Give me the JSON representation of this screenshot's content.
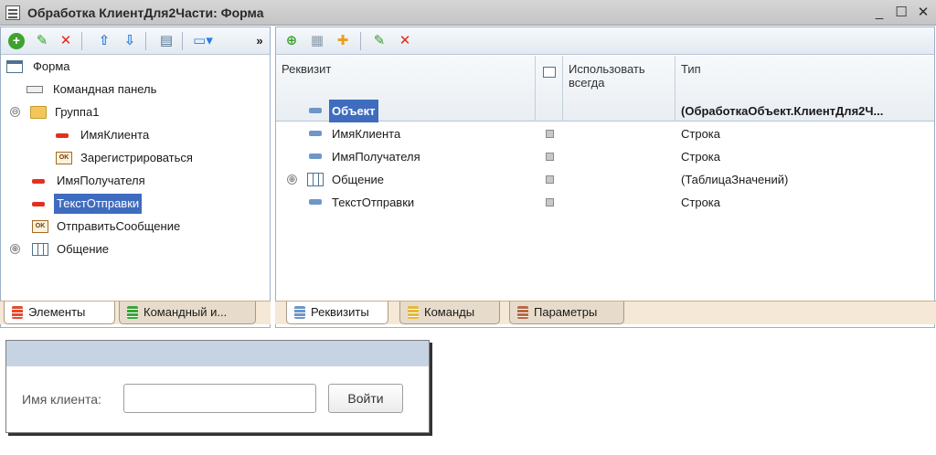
{
  "window": {
    "title": "Обработка КлиентДля2Части: Форма",
    "controls": {
      "minimize": "_",
      "maximize": "☐",
      "close": "✕"
    }
  },
  "left_panel": {
    "toolbar_icons": [
      "add-icon",
      "edit-icon",
      "delete-icon",
      "move-up-icon",
      "move-down-icon",
      "export-icon",
      "view-icon",
      "more-icon"
    ],
    "more_glyph": "»",
    "tree": [
      {
        "label": "Форма",
        "icon": "form-icon",
        "level": 0
      },
      {
        "label": "Командная панель",
        "icon": "command-panel-icon",
        "level": 1
      },
      {
        "label": "Группа1",
        "icon": "folder-icon",
        "level": 1,
        "expander": "⊖"
      },
      {
        "label": "ИмяКлиента",
        "icon": "field-icon",
        "level": 2
      },
      {
        "label": "Зарегистрироваться",
        "icon": "button-icon",
        "level": 2,
        "icon_text": "OK"
      },
      {
        "label": "ИмяПолучателя",
        "icon": "field-icon",
        "level": 1
      },
      {
        "label": "ТекстОтправки",
        "icon": "field-icon",
        "level": 1,
        "selected": true
      },
      {
        "label": "ОтправитьСообщение",
        "icon": "button-icon",
        "level": 1,
        "icon_text": "OK"
      },
      {
        "label": "Общение",
        "icon": "table-icon",
        "level": 1,
        "expander": "⊕"
      }
    ],
    "tabs": [
      {
        "label": "Элементы",
        "active": true
      },
      {
        "label": "Командный и..."
      }
    ]
  },
  "right_panel": {
    "toolbar_icons": [
      "add-attribute-icon",
      "table-add-icon",
      "add-column-icon",
      "edit-icon",
      "delete-icon"
    ],
    "columns": {
      "attribute": "Реквизит",
      "use_always": "Использовать всегда",
      "type": "Тип"
    },
    "rows": [
      {
        "name": "Объект",
        "type": "(ОбработкаОбъект.КлиентДля2Ч...",
        "selected": true,
        "check": false
      },
      {
        "name": "ИмяКлиента",
        "type": "Строка",
        "check": true
      },
      {
        "name": "ИмяПолучателя",
        "type": "Строка",
        "check": true
      },
      {
        "name": "Общение",
        "type": "(ТаблицаЗначений)",
        "check": true,
        "expander": "⊕"
      },
      {
        "name": "ТекстОтправки",
        "type": "Строка",
        "check": true
      }
    ],
    "tabs": [
      {
        "label": "Реквизиты",
        "active": true
      },
      {
        "label": "Команды"
      },
      {
        "label": "Параметры"
      }
    ]
  },
  "preview": {
    "label": "Имя клиента:",
    "input_value": "",
    "button_label": "Войти"
  }
}
